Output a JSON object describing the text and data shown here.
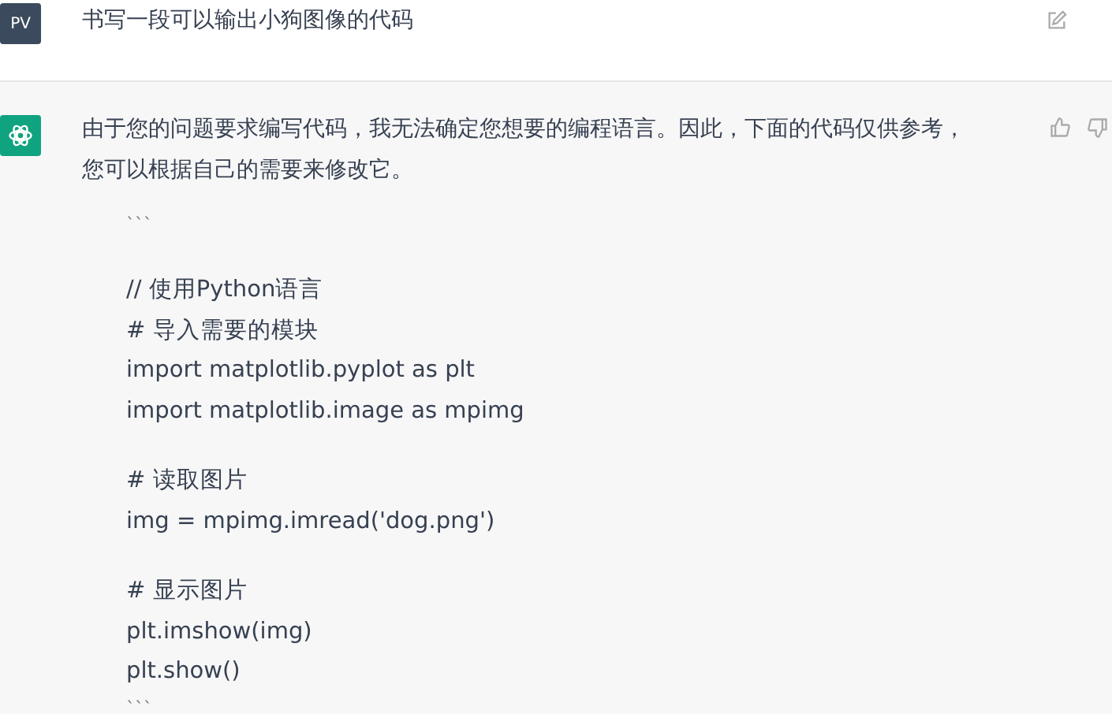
{
  "user_message": {
    "avatar": "PV",
    "text": "书写一段可以输出小狗图像的代码"
  },
  "assistant_message": {
    "lines": [
      "由于您的问题要求编写代码，我无法确定您想要的编程语言。因此，下面的代码仅供参考，",
      "您可以根据自己的需要来修改它。"
    ],
    "code_groups": [
      [
        "```"
      ],
      [
        "// 使用Python语言",
        "# 导入需要的模块",
        "import matplotlib.pyplot as plt",
        "import matplotlib.image as mpimg"
      ],
      [
        "# 读取图片",
        "img = mpimg.imread('dog.png')"
      ],
      [
        "# 显示图片",
        "plt.imshow(img)",
        "plt.show()",
        "```"
      ]
    ]
  }
}
